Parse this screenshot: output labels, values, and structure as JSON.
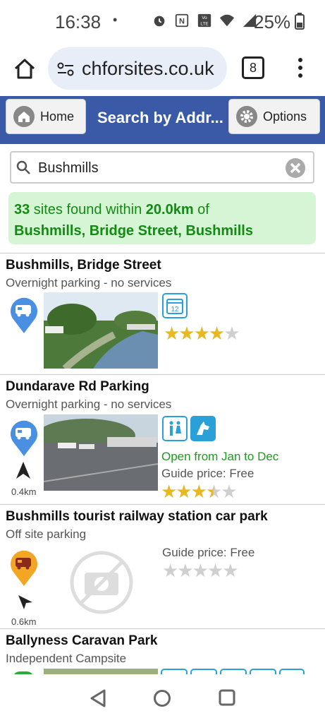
{
  "status": {
    "time": "16:38",
    "dot": "•",
    "battery": "25%"
  },
  "browser": {
    "url": "chforsites.co.uk",
    "tab_count": "8"
  },
  "appbar": {
    "home_label": "Home",
    "title": "Search by Addr...",
    "options_label": "Options"
  },
  "search": {
    "value": "Bushmills"
  },
  "results": {
    "count": "33",
    "pre": " sites found within ",
    "distance": "20.0km",
    "post": " of",
    "location": "Bushmills, Bridge Street, Bushmills"
  },
  "sites": [
    {
      "name": "Bushmills, Bridge Street",
      "type": "Overnight parking - no services",
      "calendar_day": "12",
      "rating": 4,
      "pin_color": "#4a90e2"
    },
    {
      "name": "Dundarave Rd Parking",
      "type": "Overnight parking - no services",
      "open": "Open from Jan to Dec",
      "price": "Guide price: Free",
      "rating": 3.5,
      "distance": "0.4km",
      "pin_color": "#4a90e2"
    },
    {
      "name": "Bushmills tourist railway station car park",
      "type": "Off site parking",
      "price": "Guide price: Free",
      "rating": 0,
      "distance": "0.6km",
      "pin_color": "#f3a623"
    },
    {
      "name": "Ballyness Caravan Park",
      "type": "Independent Campsite"
    }
  ]
}
